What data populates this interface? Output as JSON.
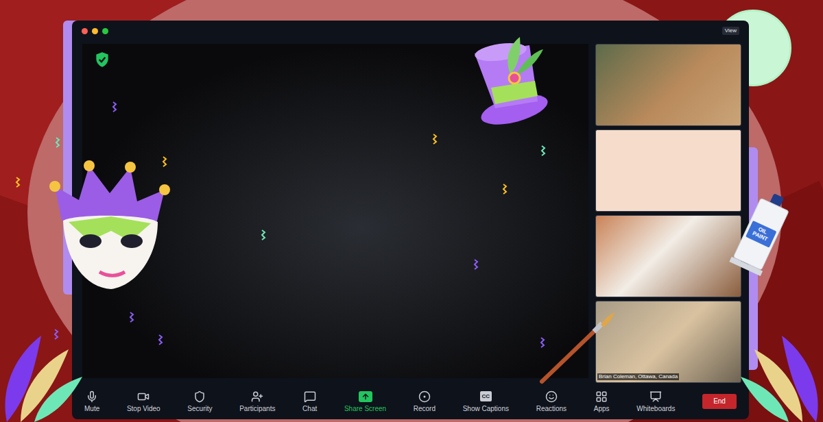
{
  "window": {
    "view_button": "View"
  },
  "main_video": {
    "secure": true
  },
  "thumbnails": [
    {
      "caption": null
    },
    {
      "caption": null
    },
    {
      "caption": null
    },
    {
      "caption": "Brian Coleman, Ottawa, Canada"
    }
  ],
  "toolbar": {
    "buttons": [
      {
        "label": "Mute",
        "highlighted": false
      },
      {
        "label": "Stop Video",
        "highlighted": false
      },
      {
        "label": "Security",
        "highlighted": false
      },
      {
        "label": "Participants",
        "highlighted": false
      },
      {
        "label": "Chat",
        "highlighted": false
      },
      {
        "label": "Share Screen",
        "highlighted": true
      },
      {
        "label": "Record",
        "highlighted": false
      },
      {
        "label": "Show Captions",
        "highlighted": false,
        "glyph": "CC"
      },
      {
        "label": "Reactions",
        "highlighted": false
      },
      {
        "label": "Apps",
        "highlighted": false
      },
      {
        "label": "Whiteboards",
        "highlighted": false
      }
    ],
    "end_button": "End"
  },
  "decorations": {
    "paint_tube_label": [
      "OIL",
      "PAINT"
    ]
  }
}
